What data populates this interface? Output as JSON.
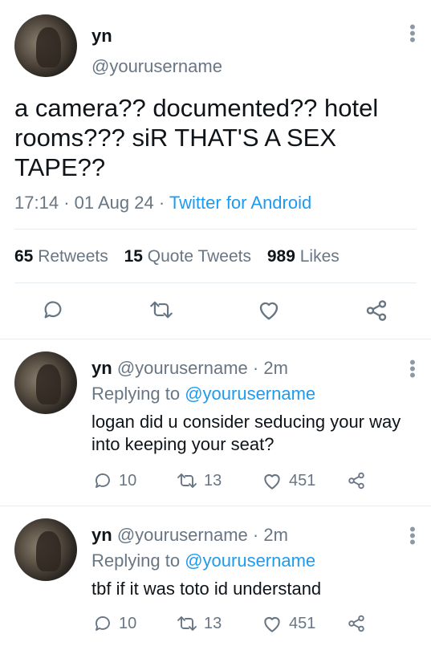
{
  "main_tweet": {
    "name": "yn",
    "handle": "@yourusername",
    "text": "a camera?? documented?? hotel rooms??? siR THAT'S A SEX TAPE??",
    "time": "17:14",
    "dot1": "·",
    "date": "01 Aug 24",
    "dot2": "·",
    "client": "Twitter for Android",
    "stats": {
      "retweets_count": "65",
      "retweets_label": "Retweets",
      "quotes_count": "15",
      "quotes_label": "Quote Tweets",
      "likes_count": "989",
      "likes_label": "Likes"
    }
  },
  "replies": [
    {
      "name": "yn",
      "handle": "@yourusername",
      "sep": "·",
      "time": "2m",
      "replying_prefix": "Replying to",
      "replying_handle": "@yourusername",
      "text": "logan did u consider seducing your way into keeping your seat?",
      "reply_count": "10",
      "retweet_count": "13",
      "like_count": "451"
    },
    {
      "name": "yn",
      "handle": "@yourusername",
      "sep": "·",
      "time": "2m",
      "replying_prefix": "Replying to",
      "replying_handle": "@yourusername",
      "text": "tbf if it was toto id understand",
      "reply_count": "10",
      "retweet_count": "13",
      "like_count": "451"
    }
  ],
  "icons": [
    "more-icon",
    "reply-icon",
    "retweet-icon",
    "like-icon",
    "share-icon"
  ],
  "colors": {
    "accent": "#1d9bf0",
    "muted": "#687684",
    "text": "#0f1419"
  }
}
